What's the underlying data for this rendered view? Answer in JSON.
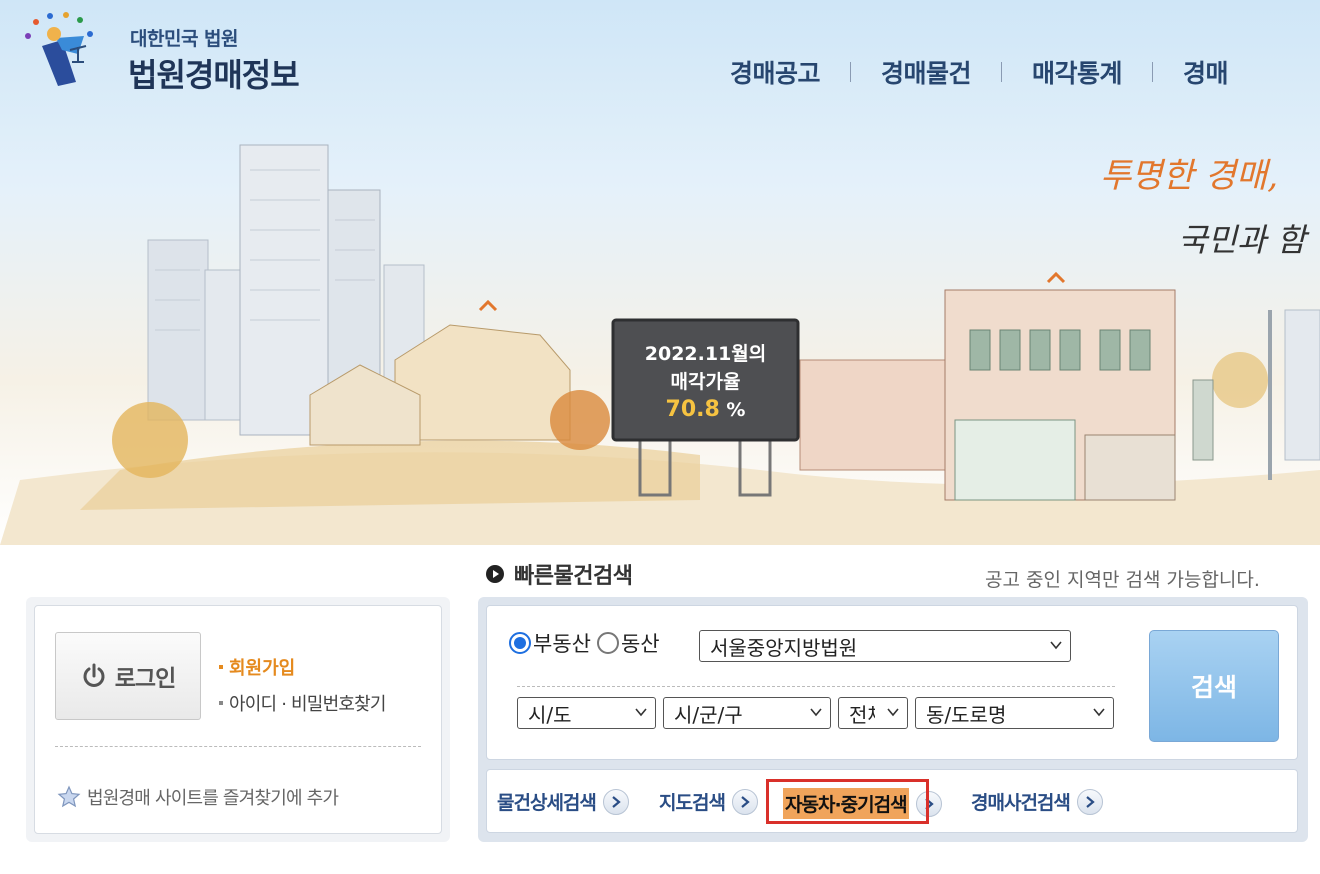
{
  "header": {
    "logo_sub": "대한민국 법원",
    "logo_main": "법원경매정보",
    "nav": [
      {
        "label": "경매공고"
      },
      {
        "label": "경매물건"
      },
      {
        "label": "매각통계"
      },
      {
        "label": "경매"
      }
    ]
  },
  "hero": {
    "slogan_line1": "투명한 경매,",
    "slogan_line2": "국민과 함",
    "billboard": {
      "line1": "2022.11월의",
      "line2": "매각가율",
      "rate": "70.8",
      "unit": "%"
    }
  },
  "quick_search": {
    "title": "빠른물건검색",
    "notice": "공고 중인 지역만 검색 가능합니다.",
    "radios": [
      {
        "label": "부동산",
        "checked": true
      },
      {
        "label": "동산",
        "checked": false
      }
    ],
    "court_select": "서울중앙지방법원",
    "sido_select": "시/도",
    "sigungu_select": "시/군/구",
    "all_select": "전체",
    "dong_select": "동/도로명",
    "search_label": "검색",
    "tabs": [
      {
        "label": "물건상세검색"
      },
      {
        "label": "지도검색"
      },
      {
        "label": "자동차·중기검색"
      },
      {
        "label": "경매사건검색"
      }
    ]
  },
  "login": {
    "login_label": "로그인",
    "join_label": "회원가입",
    "find_label": "아이디 · 비밀번호찾기",
    "favorite_label": "법원경매 사이트를 즐겨찾기에 추가"
  },
  "colors": {
    "nav_text": "#27466f",
    "accent_orange": "#e58a1e",
    "tab_text": "#2a4d85",
    "highlight": "#f0a45b",
    "outline_red": "#d9302a",
    "search_button": "#7db6e5"
  }
}
